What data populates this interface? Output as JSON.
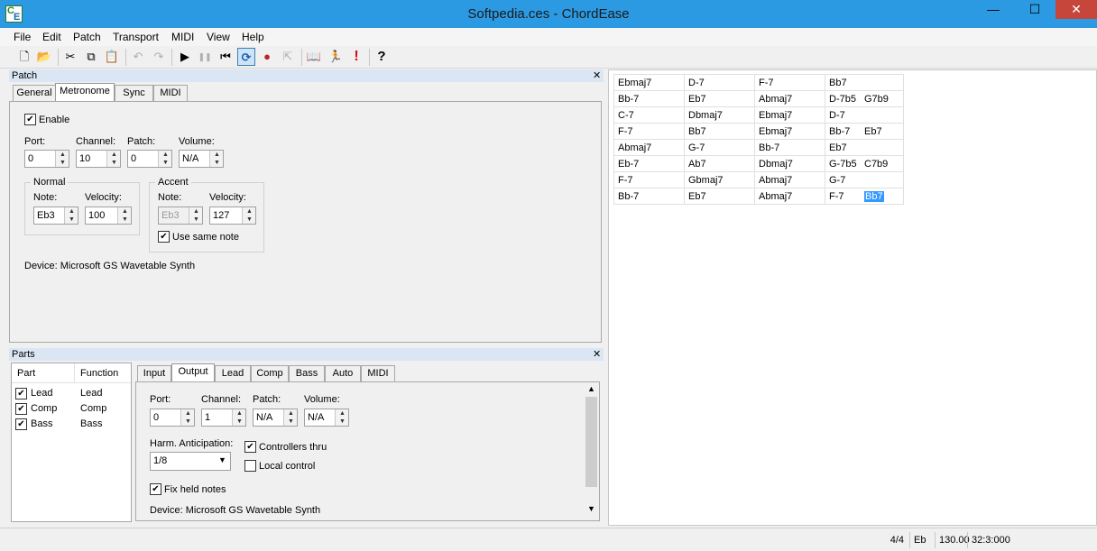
{
  "window": {
    "title": "Softpedia.ces - ChordEase",
    "min": "—",
    "max": "☐",
    "close": "✕"
  },
  "menu": [
    "File",
    "Edit",
    "Patch",
    "Transport",
    "MIDI",
    "View",
    "Help"
  ],
  "toolbar": {
    "new": "🗋",
    "open": "📂",
    "cut": "✂",
    "copy": "⧉",
    "paste": "📋",
    "undo": "↶",
    "redo": "↷",
    "play": "▶",
    "pause": "❚❚",
    "rewind": "⏮",
    "loop": "⟳",
    "record": "●",
    "punch": "⇱",
    "book": "📖",
    "run": "🏃",
    "alert": "!",
    "help": "?"
  },
  "patch": {
    "title": "Patch",
    "tabs": [
      "General",
      "Metronome",
      "Sync",
      "MIDI"
    ],
    "enable": "Enable",
    "labels": {
      "port": "Port:",
      "channel": "Channel:",
      "patch": "Patch:",
      "volume": "Volume:"
    },
    "values": {
      "port": "0",
      "channel": "10",
      "patch": "0",
      "volume": "N/A"
    },
    "normal": {
      "title": "Normal",
      "note_label": "Note:",
      "velocity_label": "Velocity:",
      "note": "Eb3",
      "velocity": "100"
    },
    "accent": {
      "title": "Accent",
      "note_label": "Note:",
      "velocity_label": "Velocity:",
      "note": "Eb3",
      "velocity": "127",
      "same_note": "Use same note"
    },
    "device": "Device:  Microsoft GS Wavetable Synth"
  },
  "parts": {
    "title": "Parts",
    "headers": [
      "Part",
      "Function"
    ],
    "rows": [
      [
        "Lead",
        "Lead"
      ],
      [
        "Comp",
        "Comp"
      ],
      [
        "Bass",
        "Bass"
      ]
    ],
    "tabs": [
      "Input",
      "Output",
      "Lead",
      "Comp",
      "Bass",
      "Auto",
      "MIDI"
    ],
    "labels": {
      "port": "Port:",
      "channel": "Channel:",
      "patch": "Patch:",
      "volume": "Volume:"
    },
    "values": {
      "port": "0",
      "channel": "1",
      "patch": "N/A",
      "volume": "N/A"
    },
    "harm_label": "Harm. Anticipation:",
    "harm_value": "1/8",
    "controllers_thru": "Controllers thru",
    "local_control": "Local control",
    "fix_held": "Fix held notes",
    "device": "Device:  Microsoft GS Wavetable Synth"
  },
  "chords": [
    [
      "Ebmaj7",
      "D-7",
      "F-7",
      "Bb7"
    ],
    [
      "Bb-7",
      "Eb7",
      "Abmaj7",
      "D-7b5|G7b9"
    ],
    [
      "C-7",
      "Dbmaj7",
      "Ebmaj7",
      "D-7"
    ],
    [
      "F-7",
      "Bb7",
      "Ebmaj7",
      "Bb-7|Eb7"
    ],
    [
      "Abmaj7",
      "G-7",
      "Bb-7",
      "Eb7"
    ],
    [
      "Eb-7",
      "Ab7",
      "Dbmaj7",
      "G-7b5|C7b9"
    ],
    [
      "F-7",
      "Gbmaj7",
      "Abmaj7",
      "G-7"
    ],
    [
      "Bb-7",
      "Eb7",
      "Abmaj7",
      "F-7|Bb7"
    ]
  ],
  "status": {
    "meter": "4/4",
    "key": "Eb",
    "tempo": "130.00",
    "position": "32:3:000"
  }
}
